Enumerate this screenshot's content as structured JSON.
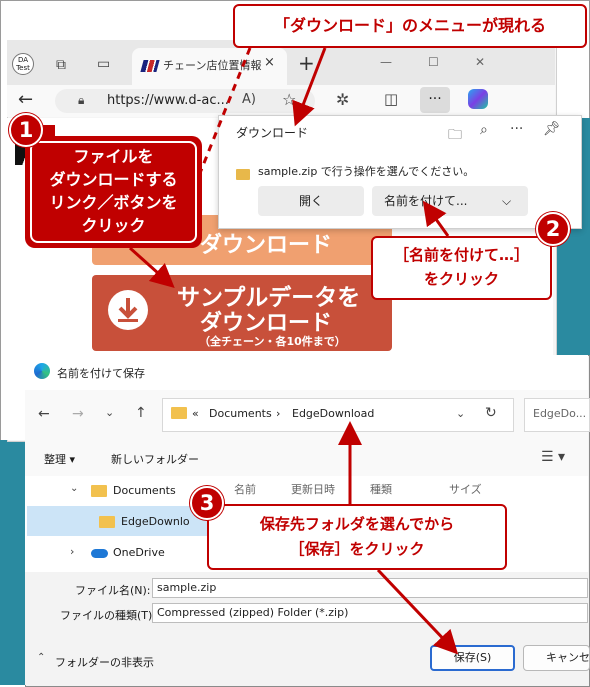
{
  "browser": {
    "profile_badge": "DA Test",
    "tab_title": "チェーン店位置情報",
    "tab_close": "×",
    "new_tab": "+",
    "url": "https://www.d-ac...",
    "icons": [
      "back-icon",
      "lock-icon",
      "read-aloud-icon",
      "favorite-icon",
      "extensions-icon",
      "split-screen-icon",
      "more-icon",
      "copilot-icon"
    ]
  },
  "webpage": {
    "orange_button": "ダウンロード",
    "red_button_line1": "サンプルデータを",
    "red_button_line2": "ダウンロード",
    "red_button_note": "（全チェーン・各10件まで）"
  },
  "download_panel": {
    "title": "ダウンロード",
    "message": "sample.zip で行う操作を選んでください。",
    "open_button": "開く",
    "save_as_button": "名前を付けて..."
  },
  "save_dialog": {
    "title": "名前を付けて保存",
    "path": [
      "«",
      "Documents",
      "›",
      "EdgeDownload"
    ],
    "search_placeholder": "EdgeDo...",
    "organize": "整理 ▾",
    "new_folder": "新しいフォルダー",
    "columns": [
      "名前",
      "更新日時",
      "種類",
      "サイズ"
    ],
    "tree": [
      {
        "label": "Documents",
        "expanded": true
      },
      {
        "label": "EdgeDownlo",
        "selected": true
      },
      {
        "label": "OneDrive",
        "expanded": false
      }
    ],
    "filename_label": "ファイル名(N):",
    "filename_value": "sample.zip",
    "filetype_label": "ファイルの種類(T):",
    "filetype_value": "Compressed (zipped) Folder (*.zip)",
    "hide_folders": "フォルダーの非表示",
    "save_button": "保存(S)",
    "cancel_button": "キャンセル"
  },
  "callouts": {
    "top": "「ダウンロード」のメニューが現れる",
    "step1": [
      "ファイルを",
      "ダウンロードする",
      "リンク／ボタンを",
      "クリック"
    ],
    "step2": [
      "［名前を付けて…］",
      "をクリック"
    ],
    "step3": [
      "保存先フォルダを選んでから",
      "［保存］をクリック"
    ],
    "badges": [
      "1",
      "2",
      "3"
    ]
  },
  "colors": {
    "accent_red": "#c00000",
    "desktop_teal": "#2a8aa0",
    "orange_button": "#f0a070",
    "red_button": "#c8503a"
  }
}
